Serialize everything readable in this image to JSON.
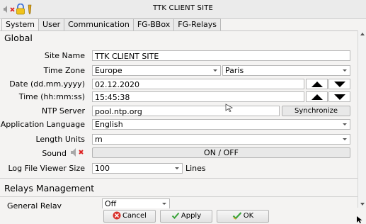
{
  "window": {
    "title": "TTK CLIENT SITE"
  },
  "tabs": [
    "System",
    "User",
    "Communication",
    "FG-BBox",
    "FG-Relays"
  ],
  "sections": {
    "global": "Global",
    "relays": "Relays Management"
  },
  "fields": {
    "site_name": {
      "label": "Site Name",
      "value": "TTK CLIENT SITE"
    },
    "time_zone": {
      "label": "Time Zone",
      "region": "Europe",
      "city": "Paris"
    },
    "date": {
      "label": "Date (dd.mm.yyyy)",
      "value": "02.12.2020"
    },
    "time": {
      "label": "Time (hh:mm:ss)",
      "value": "15:45:38"
    },
    "ntp": {
      "label": "NTP Server",
      "value": "pool.ntp.org",
      "sync_label": "Synchronize"
    },
    "language": {
      "label": "Application Language",
      "value": "English"
    },
    "length_units": {
      "label": "Length Units",
      "value": "m"
    },
    "sound": {
      "label": "Sound",
      "toggle_label": "ON / OFF"
    },
    "log_viewer": {
      "label": "Log File Viewer Size",
      "value": "100",
      "unit": "Lines"
    },
    "general_relay": {
      "label": "General Relay",
      "value": "Off"
    }
  },
  "buttons": {
    "cancel": "Cancel",
    "apply": "Apply",
    "ok": "OK"
  },
  "colors": {
    "cancel_icon": "#d9312b",
    "check_icon": "#3aa43a",
    "accent_blue": "#3a6fd8"
  }
}
